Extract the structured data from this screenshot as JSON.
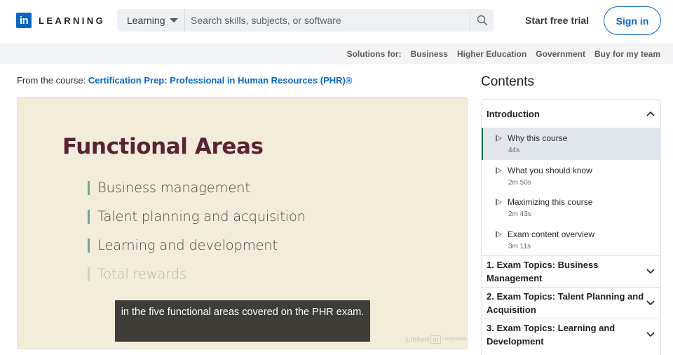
{
  "header": {
    "logo_mark": "in",
    "logo_text": "LEARNING",
    "search_category": "Learning",
    "search_placeholder": "Search skills, subjects, or software",
    "search_value": "",
    "start_trial": "Start free trial",
    "sign_in": "Sign in",
    "brand_color": "#0a66c2"
  },
  "subnav": {
    "label": "Solutions for:",
    "links": [
      "Business",
      "Higher Education",
      "Government",
      "Buy for my team"
    ]
  },
  "course": {
    "prefix": "From the course:",
    "title": "Certification Prep: Professional in Human Resources (PHR)®"
  },
  "video": {
    "slide_title": "Functional Areas",
    "bullets": [
      "Business management",
      "Talent planning and acquisition",
      "Learning and development",
      "Total rewards"
    ],
    "caption": "in the five functional areas covered on the PHR exam.",
    "watermark_text": "Linked",
    "watermark_in": "in",
    "watermark_suffix": "LEARNING"
  },
  "contents": {
    "title": "Contents",
    "intro_chapter": "Introduction",
    "items": [
      {
        "title": "Why this course",
        "duration": "44s",
        "active": true
      },
      {
        "title": "What you should know",
        "duration": "2m 50s",
        "active": false
      },
      {
        "title": "Maximizing this course",
        "duration": "2m 43s",
        "active": false
      },
      {
        "title": "Exam content overview",
        "duration": "3m 11s",
        "active": false
      }
    ],
    "sections": [
      "1. Exam Topics: Business Management",
      "2. Exam Topics: Talent Planning and Acquisition",
      "3. Exam Topics: Learning and Development"
    ],
    "active_color": "#0f7a4f"
  }
}
